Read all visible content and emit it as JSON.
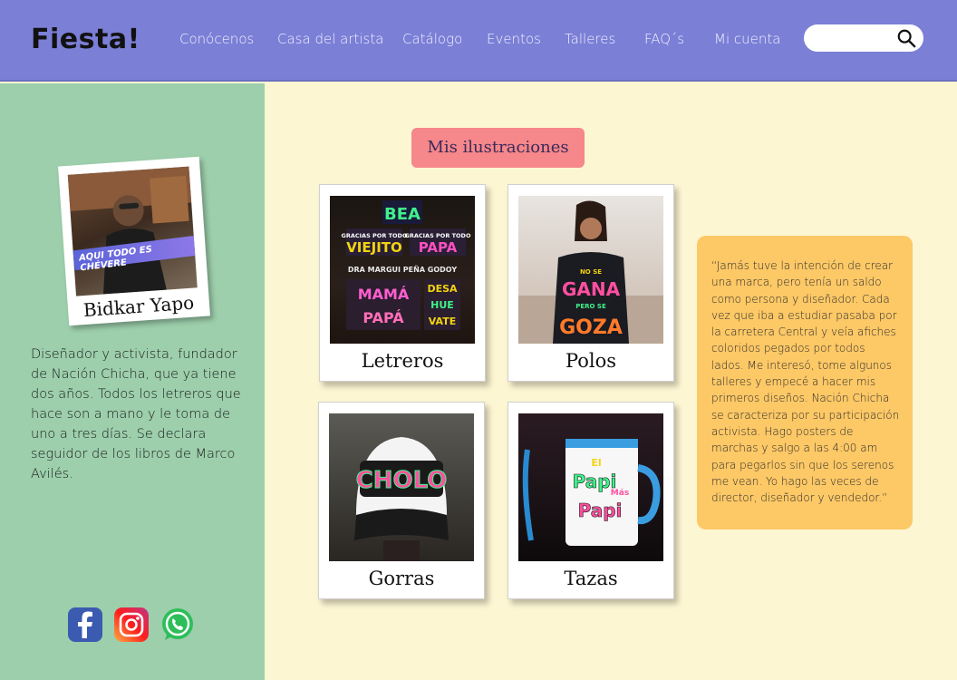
{
  "header": {
    "logo": "Fiesta!",
    "nav": [
      {
        "label": "Conócenos"
      },
      {
        "label": "Casa del artista"
      },
      {
        "label": "Catálogo"
      },
      {
        "label": "Eventos"
      },
      {
        "label": "Talleres"
      },
      {
        "label": "FAQ´s"
      },
      {
        "label": "Mi cuenta"
      }
    ],
    "search": {
      "placeholder": "",
      "icon": "search-icon"
    }
  },
  "sidebar": {
    "profile": {
      "name": "Bidkar Yapo",
      "photo_banner": "AQUI TODO ES CHÉVERE"
    },
    "bio": "Diseñador y activista, fundador de Nación Chicha, que ya tiene dos años. Todos los letreros que hace son a mano y le toma de uno a tres días. Se declara seguidor de los libros de Marco Avilés.",
    "social": [
      {
        "icon": "facebook-icon"
      },
      {
        "icon": "instagram-icon"
      },
      {
        "icon": "whatsapp-icon"
      }
    ]
  },
  "main": {
    "title": "Mis ilustraciones",
    "cards": [
      {
        "label": "Letreros"
      },
      {
        "label": "Polos"
      },
      {
        "label": "Gorras"
      },
      {
        "label": "Tazas"
      }
    ],
    "image_text": {
      "letreros": [
        "BEA",
        "GRACIAS POR TODO",
        "VIEJITO",
        "GRACIAS POR TODO",
        "PAPA",
        "DRA MARGUI PEÑA GODOY",
        "MAMÁ",
        "PAPÁ",
        "DESA",
        "HUE",
        "VATE"
      ],
      "polos": [
        "NO SE",
        "GANA",
        "PERO SE",
        "GOZA"
      ],
      "gorras": [
        "CHOLO"
      ],
      "tazas": [
        "El",
        "Papi",
        "Más",
        "Papi"
      ]
    },
    "quote": "“Jamás tuve la intención de crear una marca, pero tenía un saldo como persona y diseñador. Cada vez que iba a estudiar pasaba por la carretera Central y veía afiches coloridos pegados por todos lados. Me interesó, tome algunos talleres y empecé a hacer mis primeros diseños. Nación Chicha se caracteriza por su participación activista. Hago posters de marchas y salgo a las 4:00 am para pegarlos sin que los serenos me vean. Yo hago las veces de director, diseñador y vendedor.”"
  },
  "colors": {
    "header": "#7b7fd6",
    "sidebar": "#9dcfac",
    "main_bg": "#fdf6d3",
    "title_badge": "#f6878a",
    "quote_bg": "#fdc866"
  }
}
